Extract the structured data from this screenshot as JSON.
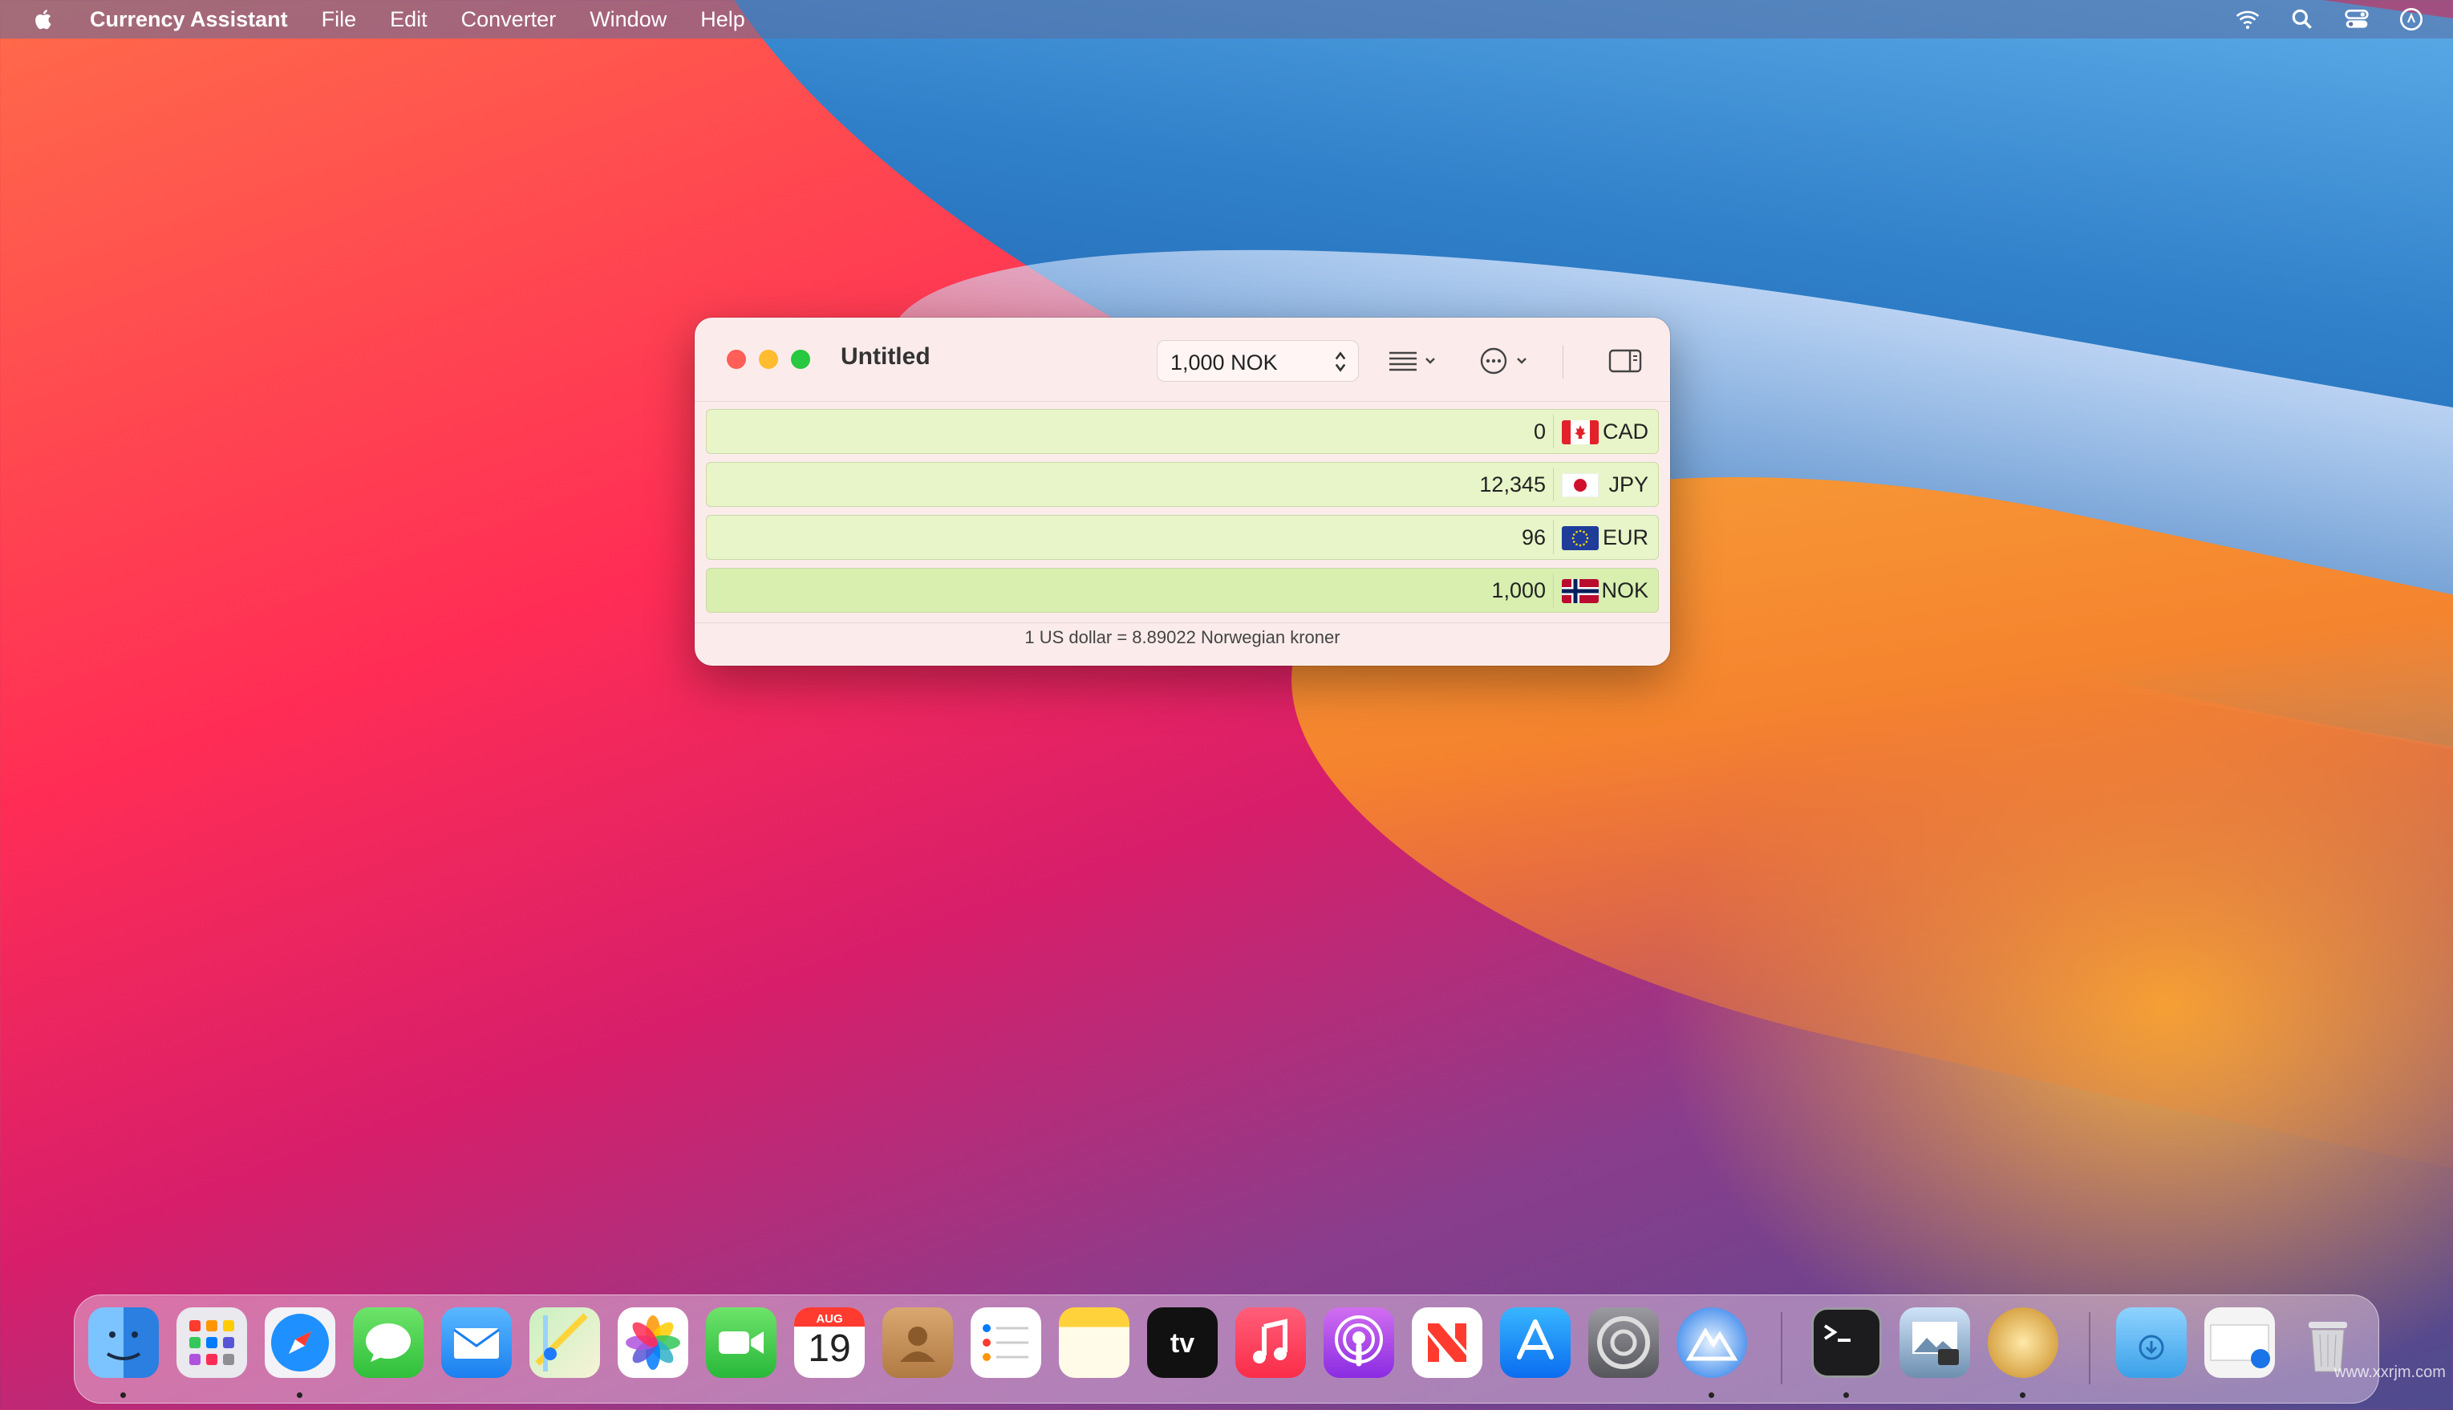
{
  "menubar": {
    "app_name": "Currency Assistant",
    "items": [
      "File",
      "Edit",
      "Converter",
      "Window",
      "Help"
    ],
    "status_icons": [
      "wifi-icon",
      "search-icon",
      "control-center-icon",
      "siri-icon"
    ]
  },
  "window": {
    "title": "Untitled",
    "amount_stepper_value": "1,000 NOK",
    "toolbar_icons": [
      "list-menu-icon",
      "more-options-icon",
      "sidebar-toggle-icon"
    ],
    "rows": [
      {
        "amount": "0",
        "code": "CAD",
        "flag": "canada-flag-icon",
        "active": false
      },
      {
        "amount": "12,345",
        "code": "JPY",
        "flag": "japan-flag-icon",
        "active": false
      },
      {
        "amount": "96",
        "code": "EUR",
        "flag": "eu-flag-icon",
        "active": false
      },
      {
        "amount": "1,000",
        "code": "NOK",
        "flag": "norway-flag-icon",
        "active": true
      }
    ],
    "status_text": "1 US dollar = 8.89022 Norwegian kroner"
  },
  "dock": {
    "apps": [
      "Finder",
      "Launchpad",
      "Safari",
      "Messages",
      "Mail",
      "Maps",
      "Photos",
      "FaceTime",
      "Calendar",
      "Contacts",
      "Reminders",
      "Notes",
      "TV",
      "Music",
      "Podcasts",
      "News",
      "App Store",
      "System Preferences",
      "Currency Assistant",
      "Terminal",
      "Preview",
      "Console",
      "Downloads",
      "Screenshot",
      "Trash"
    ],
    "calendar_month": "AUG",
    "calendar_day": "19",
    "tv_label": "tv"
  },
  "watermark": "www.xxrjm.com",
  "colors": {
    "row_bg": "#e8f5c8",
    "row_active_bg": "#d8efb0",
    "window_bg": "#fbeceb"
  }
}
